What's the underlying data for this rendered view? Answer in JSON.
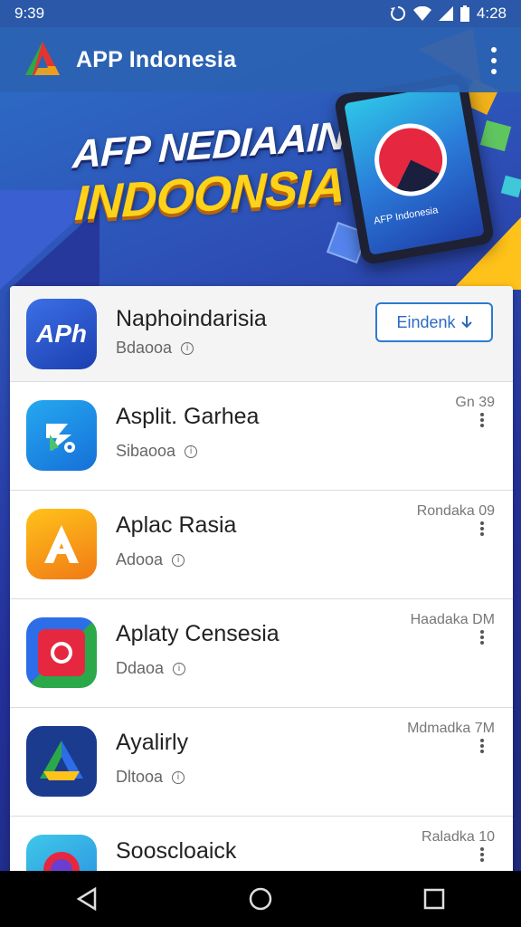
{
  "status": {
    "time_left": "9:39",
    "time_right": "4:28"
  },
  "app_bar": {
    "title": "APP Indonesia"
  },
  "banner": {
    "line1": "AFP NEDIAAIN",
    "line2": "INDOONSIA",
    "tablet_label": "AFP Indonesia"
  },
  "colors": {
    "accent": "#2c7bd2",
    "banner_yellow": "#ffd21a",
    "app_bar": "#2b62b2"
  },
  "apps": [
    {
      "title": "Naphoindarisia",
      "sub": "Bdaooa",
      "action": "Eindenk",
      "icon": "app-indonesia-icon"
    },
    {
      "title": "Asplit. Garhea",
      "sub": "Sibaooa",
      "meta": "Gn 39",
      "icon": "tool-icon"
    },
    {
      "title": "Aplac Rasia",
      "sub": "Adooa",
      "meta": "Rondaka 09",
      "icon": "letter-a-icon"
    },
    {
      "title": "Aplaty Censesia",
      "sub": "Ddaoa",
      "meta": "Haadaka DM",
      "icon": "photo-icon"
    },
    {
      "title": "Ayalirly",
      "sub": "Dltooa",
      "meta": "Mdmadka 7M",
      "icon": "drive-icon"
    },
    {
      "title": "Sooscloaick",
      "sub": "",
      "meta": "Raladka 10",
      "icon": "camera-icon"
    }
  ]
}
